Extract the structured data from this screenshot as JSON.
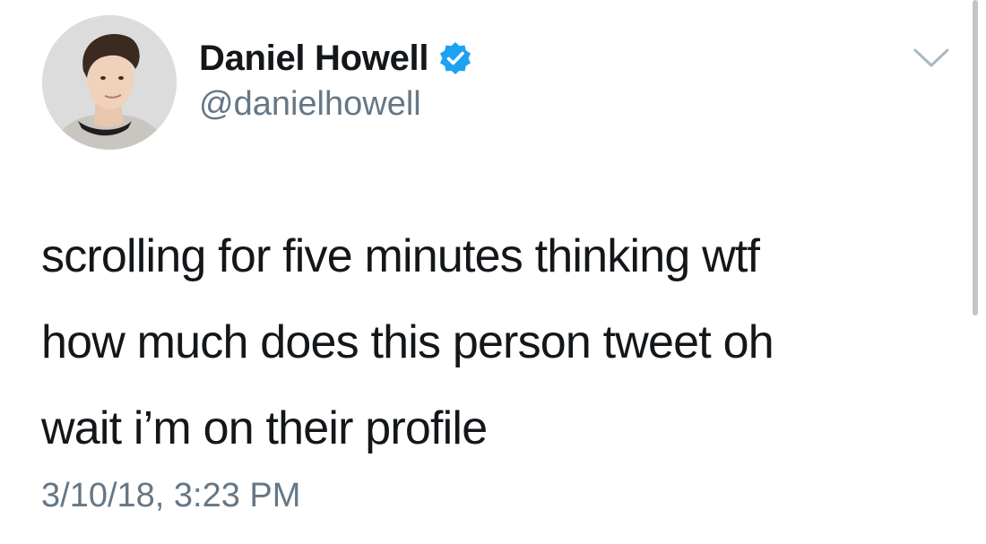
{
  "tweet": {
    "author": {
      "name": "Daniel Howell",
      "handle": "@danielhowell",
      "verified": true
    },
    "text_lines": [
      "scrolling for five minutes thinking wtf",
      "how much does this person tweet oh",
      "wait i’m on their profile"
    ],
    "timestamp": "3/10/18, 3:23 PM"
  },
  "colors": {
    "primary_text": "#14171a",
    "secondary_text": "#657786",
    "verified_badge": "#1da1f2",
    "chevron": "#aab8c2"
  },
  "icons": {
    "verified": "verified-badge-icon",
    "menu": "chevron-down-icon"
  }
}
